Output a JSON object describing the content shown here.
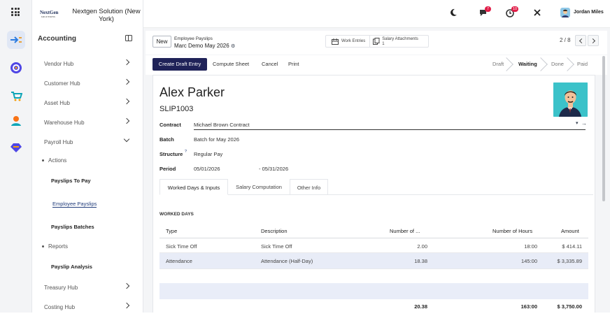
{
  "company": {
    "name": "Nextgen Solution (New York)",
    "logo_text": "NextGen",
    "logo_sub": "SOLUTIONS"
  },
  "sidebar": {
    "title": "Accounting",
    "items": [
      {
        "label": "Vendor Hub"
      },
      {
        "label": "Customer Hub"
      },
      {
        "label": "Asset Hub"
      },
      {
        "label": "Warehouse Hub"
      },
      {
        "label": "Payroll Hub"
      },
      {
        "label": "Actions"
      },
      {
        "label": "Payslips To Pay"
      },
      {
        "label": "Employee Payslips"
      },
      {
        "label": "Payslips Batches"
      },
      {
        "label": "Reports"
      },
      {
        "label": "Payslip Analysis"
      },
      {
        "label": "Treasury Hub"
      },
      {
        "label": "Costing Hub"
      }
    ]
  },
  "topbar": {
    "chat_badge": "7",
    "activity_badge": "10",
    "user_name": "Jordan Miles"
  },
  "control": {
    "new_label": "New",
    "breadcrumb_parent": "Employee Payslips",
    "breadcrumb_current": "Marc Demo May 2026",
    "stat_work_entries": "Work Entries",
    "stat_salary_attachments": "Salary Attachments",
    "stat_salary_attachments_count": "1",
    "pager": "2 / 8"
  },
  "actions": {
    "create_draft": "Create Draft Entry",
    "compute": "Compute Sheet",
    "cancel": "Cancel",
    "print": "Print",
    "statuses": [
      "Draft",
      "Waiting",
      "Done",
      "Paid"
    ]
  },
  "form": {
    "employee": "Alex Parker",
    "reference": "SLIP1003",
    "contract_label": "Contract",
    "contract_value": "Michael Brown Contract",
    "batch_label": "Batch",
    "batch_value": "Batch for May 2026",
    "structure_label": "Structure",
    "structure_help": "?",
    "structure_value": "Regular Pay",
    "period_label": "Period",
    "period_from": "05/01/2026",
    "period_to": "- 05/31/2026",
    "tabs": [
      "Worked Days & Inputs",
      "Salary Computation",
      "Other Info"
    ],
    "worked_days_title": "WORKED DAYS",
    "table": {
      "headers": [
        "Type",
        "Description",
        "Number of ...",
        "Number of Hours",
        "Amount"
      ],
      "rows": [
        {
          "type": "Sick Time Off",
          "description": "Sick Time Off",
          "days": "2.00",
          "hours": "18:00",
          "amount": "$ 414.11"
        },
        {
          "type": "Attendance",
          "description": "Attendance (Half-Day)",
          "days": "18.38",
          "hours": "145:00",
          "amount": "$ 3,335.89"
        }
      ],
      "totals": {
        "days": "20.38",
        "hours": "163:00",
        "amount": "$ 3,750.00"
      }
    }
  }
}
